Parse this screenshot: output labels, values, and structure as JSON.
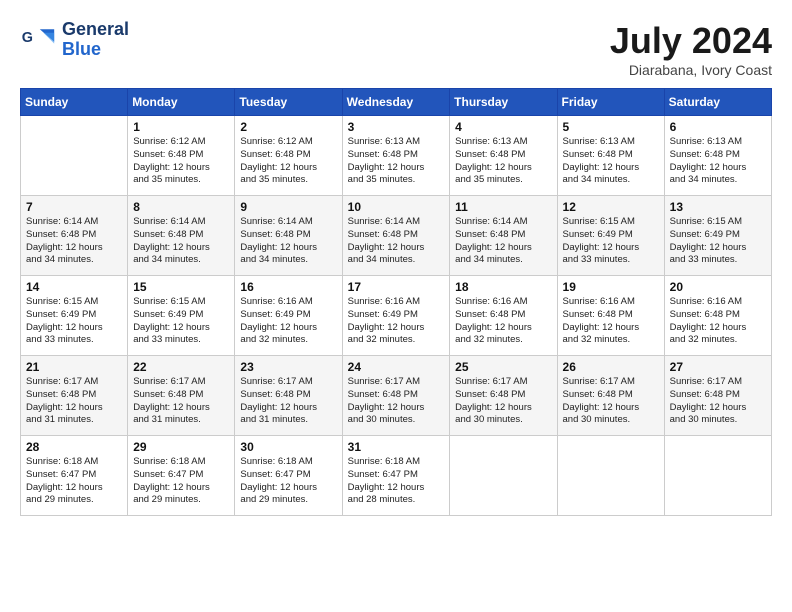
{
  "header": {
    "logo_line1": "General",
    "logo_line2": "Blue",
    "month": "July 2024",
    "location": "Diarabana, Ivory Coast"
  },
  "days_of_week": [
    "Sunday",
    "Monday",
    "Tuesday",
    "Wednesday",
    "Thursday",
    "Friday",
    "Saturday"
  ],
  "weeks": [
    [
      {
        "day": "",
        "info": ""
      },
      {
        "day": "1",
        "info": "Sunrise: 6:12 AM\nSunset: 6:48 PM\nDaylight: 12 hours\nand 35 minutes."
      },
      {
        "day": "2",
        "info": "Sunrise: 6:12 AM\nSunset: 6:48 PM\nDaylight: 12 hours\nand 35 minutes."
      },
      {
        "day": "3",
        "info": "Sunrise: 6:13 AM\nSunset: 6:48 PM\nDaylight: 12 hours\nand 35 minutes."
      },
      {
        "day": "4",
        "info": "Sunrise: 6:13 AM\nSunset: 6:48 PM\nDaylight: 12 hours\nand 35 minutes."
      },
      {
        "day": "5",
        "info": "Sunrise: 6:13 AM\nSunset: 6:48 PM\nDaylight: 12 hours\nand 34 minutes."
      },
      {
        "day": "6",
        "info": "Sunrise: 6:13 AM\nSunset: 6:48 PM\nDaylight: 12 hours\nand 34 minutes."
      }
    ],
    [
      {
        "day": "7",
        "info": "Sunrise: 6:14 AM\nSunset: 6:48 PM\nDaylight: 12 hours\nand 34 minutes."
      },
      {
        "day": "8",
        "info": "Sunrise: 6:14 AM\nSunset: 6:48 PM\nDaylight: 12 hours\nand 34 minutes."
      },
      {
        "day": "9",
        "info": "Sunrise: 6:14 AM\nSunset: 6:48 PM\nDaylight: 12 hours\nand 34 minutes."
      },
      {
        "day": "10",
        "info": "Sunrise: 6:14 AM\nSunset: 6:48 PM\nDaylight: 12 hours\nand 34 minutes."
      },
      {
        "day": "11",
        "info": "Sunrise: 6:14 AM\nSunset: 6:48 PM\nDaylight: 12 hours\nand 34 minutes."
      },
      {
        "day": "12",
        "info": "Sunrise: 6:15 AM\nSunset: 6:49 PM\nDaylight: 12 hours\nand 33 minutes."
      },
      {
        "day": "13",
        "info": "Sunrise: 6:15 AM\nSunset: 6:49 PM\nDaylight: 12 hours\nand 33 minutes."
      }
    ],
    [
      {
        "day": "14",
        "info": "Sunrise: 6:15 AM\nSunset: 6:49 PM\nDaylight: 12 hours\nand 33 minutes."
      },
      {
        "day": "15",
        "info": "Sunrise: 6:15 AM\nSunset: 6:49 PM\nDaylight: 12 hours\nand 33 minutes."
      },
      {
        "day": "16",
        "info": "Sunrise: 6:16 AM\nSunset: 6:49 PM\nDaylight: 12 hours\nand 32 minutes."
      },
      {
        "day": "17",
        "info": "Sunrise: 6:16 AM\nSunset: 6:49 PM\nDaylight: 12 hours\nand 32 minutes."
      },
      {
        "day": "18",
        "info": "Sunrise: 6:16 AM\nSunset: 6:48 PM\nDaylight: 12 hours\nand 32 minutes."
      },
      {
        "day": "19",
        "info": "Sunrise: 6:16 AM\nSunset: 6:48 PM\nDaylight: 12 hours\nand 32 minutes."
      },
      {
        "day": "20",
        "info": "Sunrise: 6:16 AM\nSunset: 6:48 PM\nDaylight: 12 hours\nand 32 minutes."
      }
    ],
    [
      {
        "day": "21",
        "info": "Sunrise: 6:17 AM\nSunset: 6:48 PM\nDaylight: 12 hours\nand 31 minutes."
      },
      {
        "day": "22",
        "info": "Sunrise: 6:17 AM\nSunset: 6:48 PM\nDaylight: 12 hours\nand 31 minutes."
      },
      {
        "day": "23",
        "info": "Sunrise: 6:17 AM\nSunset: 6:48 PM\nDaylight: 12 hours\nand 31 minutes."
      },
      {
        "day": "24",
        "info": "Sunrise: 6:17 AM\nSunset: 6:48 PM\nDaylight: 12 hours\nand 30 minutes."
      },
      {
        "day": "25",
        "info": "Sunrise: 6:17 AM\nSunset: 6:48 PM\nDaylight: 12 hours\nand 30 minutes."
      },
      {
        "day": "26",
        "info": "Sunrise: 6:17 AM\nSunset: 6:48 PM\nDaylight: 12 hours\nand 30 minutes."
      },
      {
        "day": "27",
        "info": "Sunrise: 6:17 AM\nSunset: 6:48 PM\nDaylight: 12 hours\nand 30 minutes."
      }
    ],
    [
      {
        "day": "28",
        "info": "Sunrise: 6:18 AM\nSunset: 6:47 PM\nDaylight: 12 hours\nand 29 minutes."
      },
      {
        "day": "29",
        "info": "Sunrise: 6:18 AM\nSunset: 6:47 PM\nDaylight: 12 hours\nand 29 minutes."
      },
      {
        "day": "30",
        "info": "Sunrise: 6:18 AM\nSunset: 6:47 PM\nDaylight: 12 hours\nand 29 minutes."
      },
      {
        "day": "31",
        "info": "Sunrise: 6:18 AM\nSunset: 6:47 PM\nDaylight: 12 hours\nand 28 minutes."
      },
      {
        "day": "",
        "info": ""
      },
      {
        "day": "",
        "info": ""
      },
      {
        "day": "",
        "info": ""
      }
    ]
  ]
}
